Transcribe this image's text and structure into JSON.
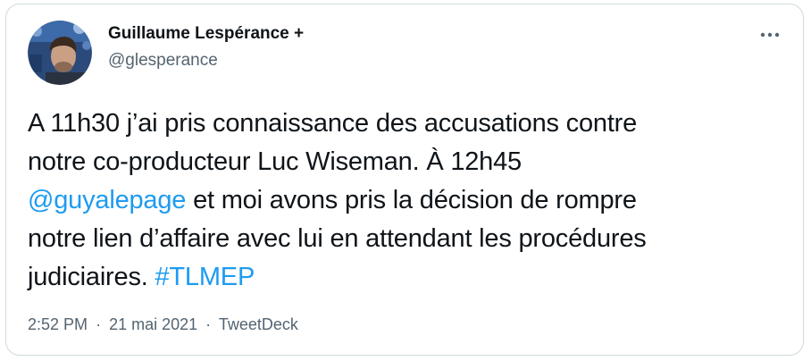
{
  "author": {
    "name": "Guillaume Lespérance +",
    "handle": "@glesperance"
  },
  "tweet": {
    "line1": "A 11h30 j’ai pris connaissance des accusations contre",
    "line2": "notre co-producteur Luc Wiseman. À 12h45",
    "mention": "@guyalepage",
    "line3_rest": " et moi avons pris la décision de rompre",
    "line4": "notre lien d’affaire avec lui en attendant les procédures",
    "line5": "judiciaires. ",
    "hashtag": "#TLMEP"
  },
  "meta": {
    "time": "2:52 PM",
    "separator": "·",
    "date": "21 mai 2021",
    "source": "TweetDeck"
  },
  "icons": {
    "more": "more-horizontal-icon",
    "avatar": "profile-photo"
  },
  "colors": {
    "link": "#1d9bf0",
    "text": "#0f1419",
    "secondary": "#536471",
    "border": "#cfd9de"
  }
}
